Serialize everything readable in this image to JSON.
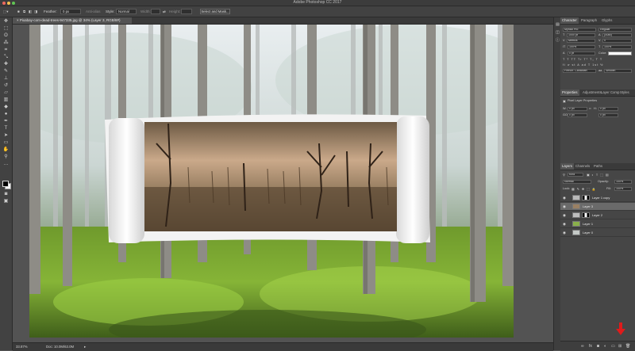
{
  "window": {
    "title": "Adobe Photoshop CC 2017",
    "traffic_colors": [
      "#ed6a5e",
      "#f5bf4f",
      "#61c554"
    ]
  },
  "options_bar": {
    "feather_label": "Feather:",
    "feather_value": "0 px",
    "antialias_label": "Anti-alias",
    "style_label": "Style:",
    "style_value": "Normal",
    "width_label": "Width:",
    "height_label": "Height:",
    "select_and_mask": "Select and Mask..."
  },
  "document": {
    "tab_title": "Pixabay-com-dead-trees-947335.jpg @ 34% (Layer 3, RGB/8#)"
  },
  "status": {
    "zoom": "33.87%",
    "doc_size": "Doc: 10.0M/63.0M"
  },
  "character_panel": {
    "tabs": [
      "Character",
      "Paragraph",
      "Glyphs"
    ],
    "font_family": "Myriad Pro",
    "font_style": "Regular",
    "font_size": "1000 pt",
    "leading": "(Auto)",
    "kerning": "Metrics",
    "tracking": "0",
    "vertical_scale": "100%",
    "horizontal_scale": "100%",
    "baseline": "0 pt",
    "color_label": "Color:",
    "language": "French: Canadian",
    "antialias_value": "Smooth"
  },
  "properties_panel": {
    "tabs": [
      "Properties",
      "Adjustments",
      "Layer Comp",
      "Styles"
    ],
    "header": "Pixel Layer Properties",
    "w_label": "W:",
    "w_value": "0 px",
    "h_label": "H:",
    "h_value": "0 px",
    "go_label": "GO",
    "x_value": "0 px",
    "y_value": "0 px"
  },
  "layers_panel": {
    "tabs": [
      "Layers",
      "Channels",
      "Paths"
    ],
    "kind_label": "Kind",
    "blend_mode": "Normal",
    "opacity_label": "Opacity:",
    "opacity_value": "100%",
    "lock_label": "Lock:",
    "fill_label": "Fill:",
    "fill_value": "100%",
    "layers": [
      {
        "name": "Layer 1 copy",
        "selected": false,
        "has_mask": true
      },
      {
        "name": "Layer 3",
        "selected": true,
        "has_mask": false
      },
      {
        "name": "Layer 2",
        "selected": false,
        "has_mask": true
      },
      {
        "name": "Layer 1",
        "selected": false,
        "has_mask": false
      },
      {
        "name": "Layer 0",
        "selected": false,
        "has_mask": false
      }
    ],
    "footer_icons": [
      "link-icon",
      "fx-icon",
      "mask-icon",
      "adjustment-icon",
      "folder-icon",
      "new-layer-icon",
      "trash-icon"
    ]
  },
  "accent": {
    "red_arrow": "#e01b1b"
  }
}
